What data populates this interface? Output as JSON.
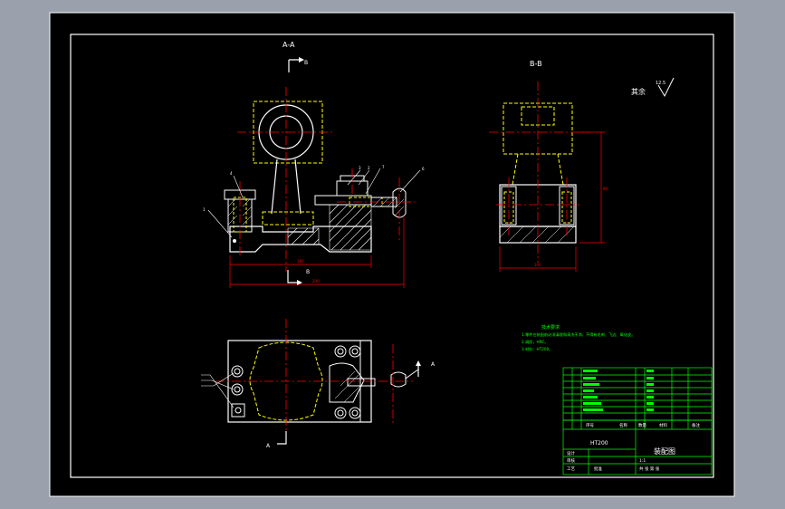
{
  "window": {
    "background": "#9aa1ac",
    "canvas": "#000000"
  },
  "colors": {
    "outline": "#ffffff",
    "hidden": "#ffff00",
    "center": "#ff0000",
    "dim": "#ff0000",
    "table": "#00ff00",
    "text": "#ffffff"
  },
  "views": {
    "section_aa": "A-A",
    "section_bb": "B-B",
    "label_b_top": "B",
    "label_b_bottom": "B",
    "label_a_right": "A",
    "label_a_bottom": "A"
  },
  "roughness": {
    "prefix": "其余",
    "value": "12.5"
  },
  "balloons": [
    "1",
    "2",
    "3",
    "4",
    "5",
    "6",
    "7"
  ],
  "tech_requirements": {
    "title": "技术要求",
    "items": [
      "1.零件在装配前必须清理和清洗干净，不得有毛刺、飞边、氧化皮。",
      "2.调质，HRC。",
      "3.材料：HT200。"
    ]
  },
  "title_block": {
    "material": "HT200",
    "drawing_name": "装配图",
    "row_headers": [
      "序号",
      "名称",
      "数量",
      "材料",
      "备注"
    ],
    "design_label": "设计",
    "check_label": "审核",
    "process_label": "工艺",
    "approve_label": "批准",
    "scale": "1:1",
    "sheet_label": "共 张 第 张"
  }
}
